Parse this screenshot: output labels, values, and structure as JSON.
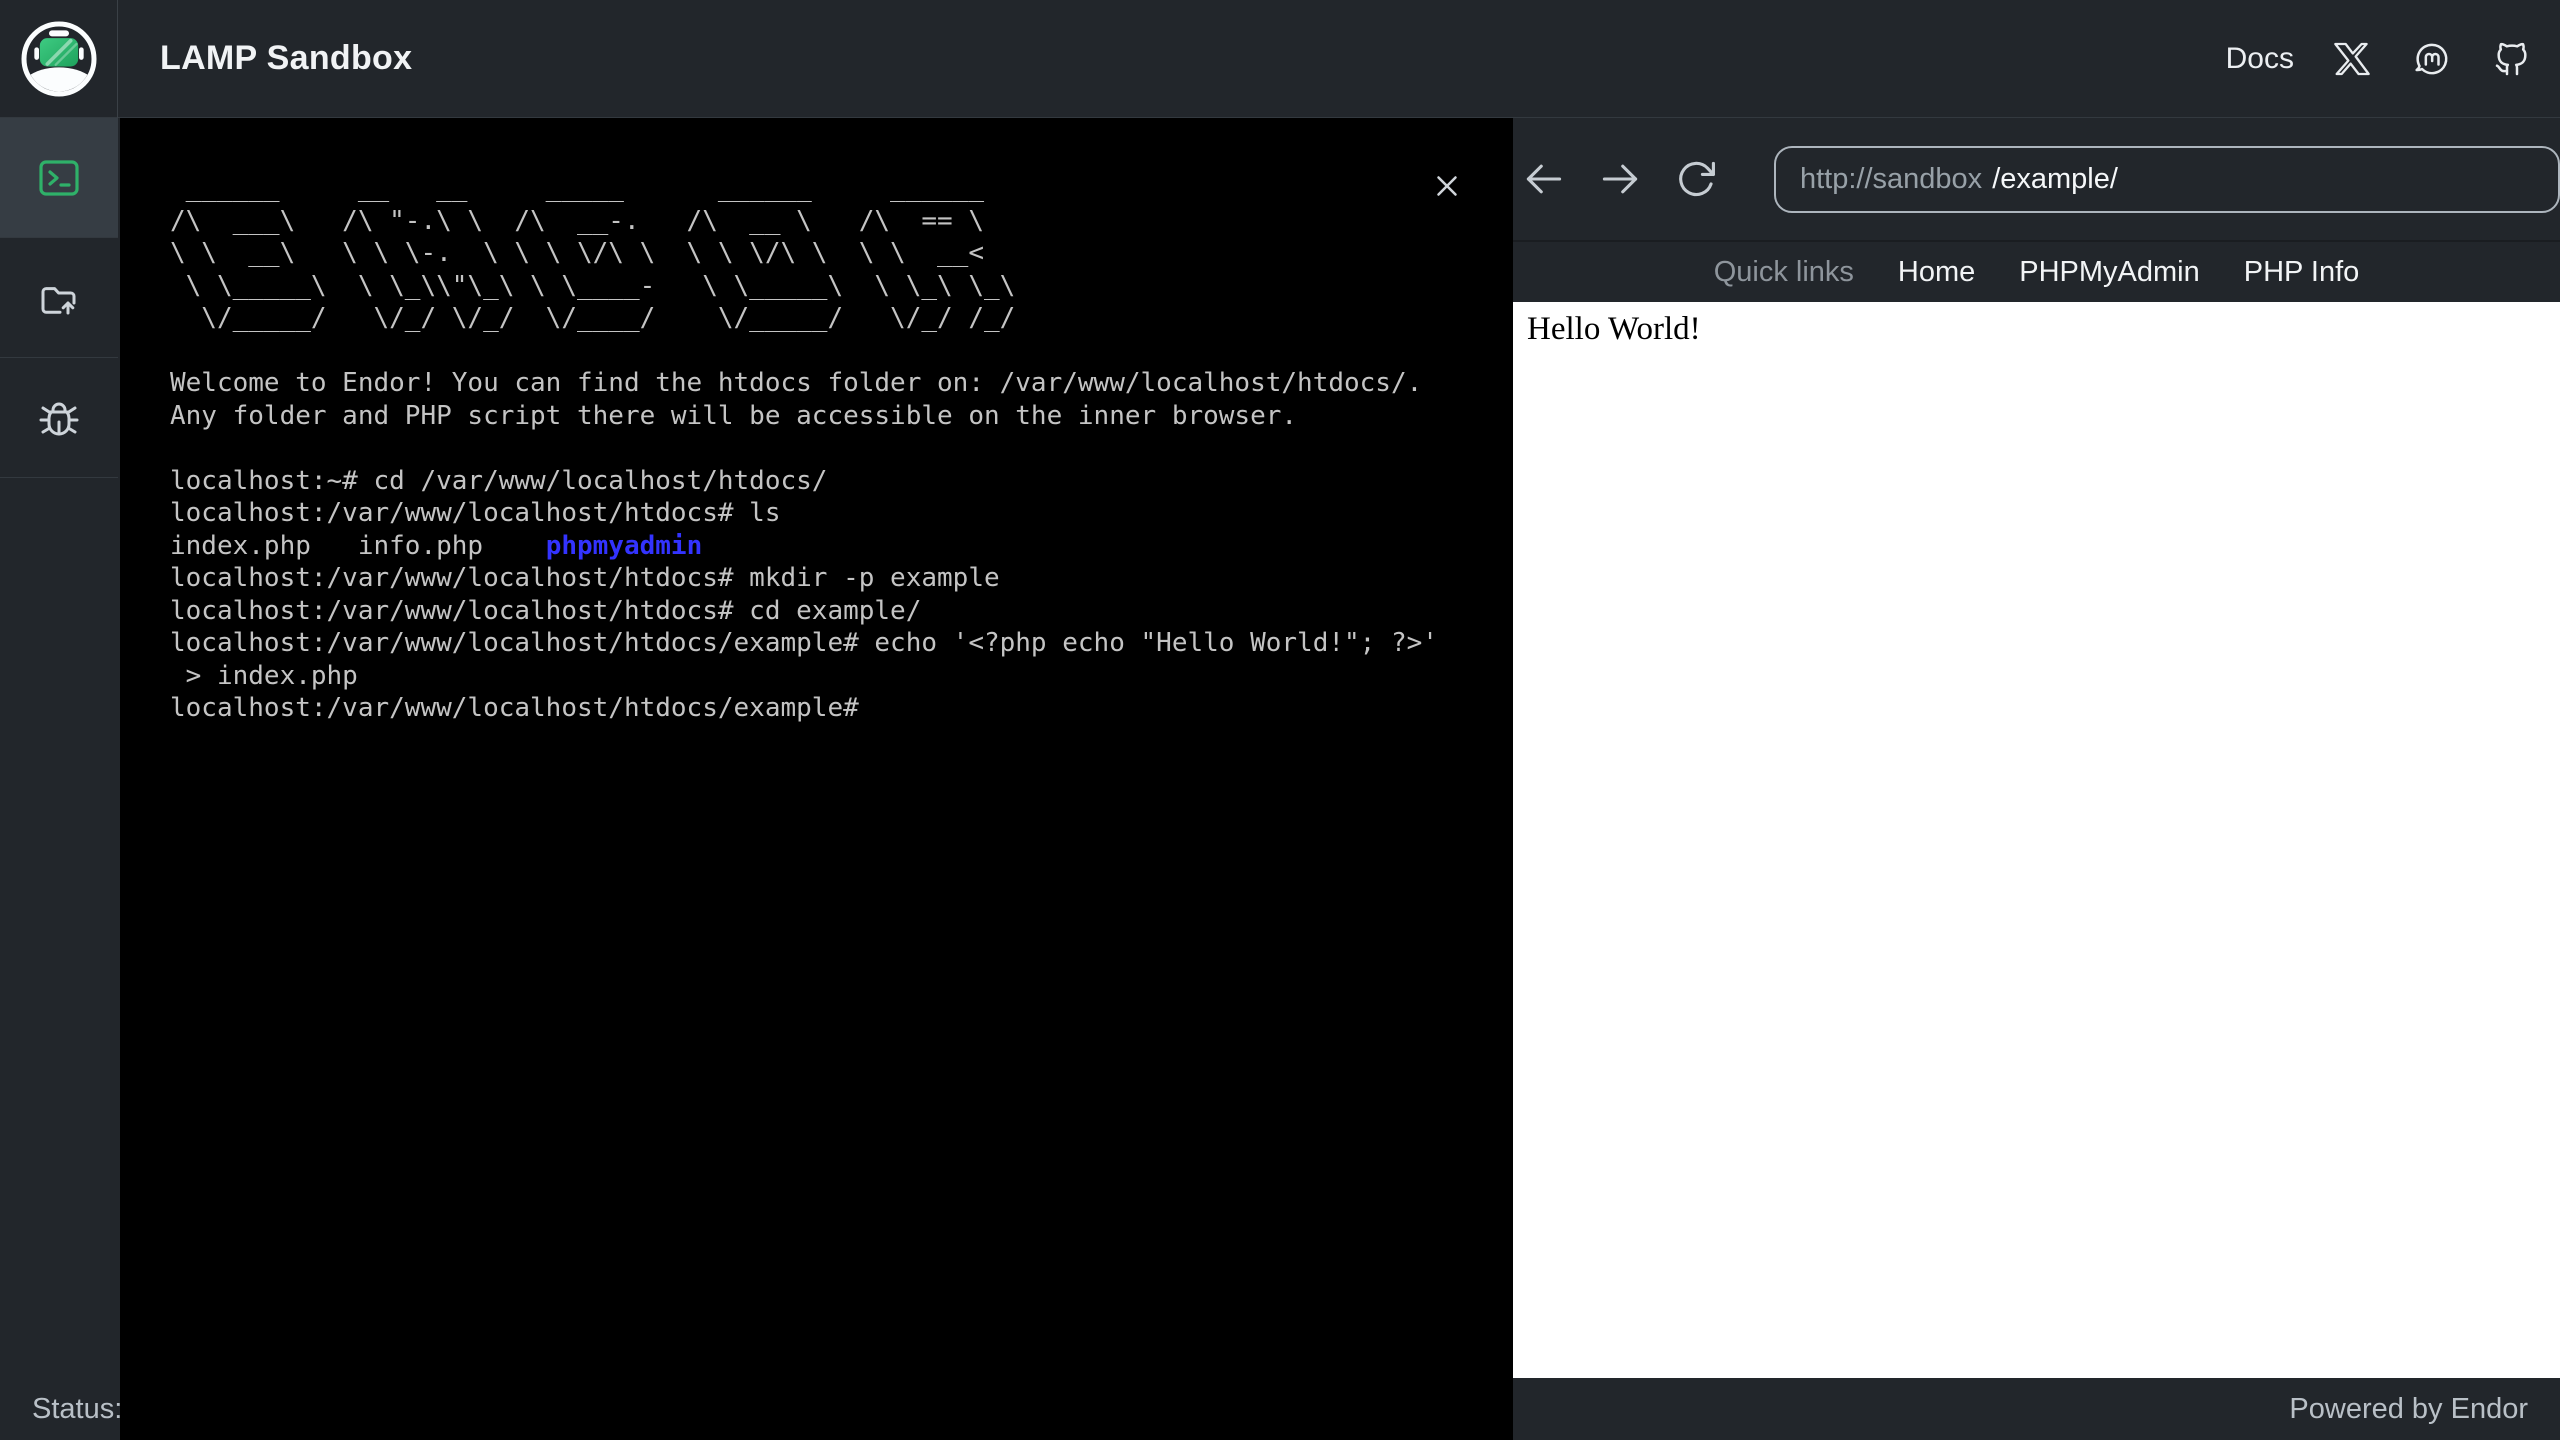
{
  "header": {
    "title": "LAMP Sandbox",
    "docs_label": "Docs"
  },
  "sidebar": {
    "items": [
      {
        "icon": "terminal-icon",
        "active": true
      },
      {
        "icon": "folder-upload-icon",
        "active": false
      },
      {
        "icon": "bug-icon",
        "active": false
      }
    ]
  },
  "terminal": {
    "ascii_art": " ______     __   __     _____      ______     ______    \n/\\  ___\\   /\\ \"-.\\ \\  /\\  __-.   /\\  __ \\   /\\  == \\   \n\\ \\  __\\   \\ \\ \\-.  \\ \\ \\ \\/\\ \\  \\ \\ \\/\\ \\  \\ \\  __<   \n \\ \\_____\\  \\ \\_\\\\\"\\_\\ \\ \\____-   \\ \\_____\\  \\ \\_\\ \\_\\ \n  \\/_____/   \\/_/ \\/_/  \\/____/    \\/_____/   \\/_/ /_/ ",
    "welcome": "Welcome to Endor! You can find the htdocs folder on: /var/www/localhost/htdocs/.\nAny folder and PHP script there will be accessible on the inner browser.",
    "session": [
      {
        "segments": [
          {
            "text": "localhost:~# cd /var/www/localhost/htdocs/"
          }
        ]
      },
      {
        "segments": [
          {
            "text": "localhost:/var/www/localhost/htdocs# ls"
          }
        ]
      },
      {
        "segments": [
          {
            "text": "index.php   info.php    "
          },
          {
            "text": "phpmyadmin",
            "color": "dir"
          }
        ]
      },
      {
        "segments": [
          {
            "text": "localhost:/var/www/localhost/htdocs# mkdir -p example"
          }
        ]
      },
      {
        "segments": [
          {
            "text": "localhost:/var/www/localhost/htdocs# cd example/"
          }
        ]
      },
      {
        "segments": [
          {
            "text": "localhost:/var/www/localhost/htdocs/example# echo '<?php echo \"Hello World!\"; ?>'"
          }
        ]
      },
      {
        "segments": [
          {
            "text": " > index.php"
          }
        ]
      },
      {
        "segments": [
          {
            "text": "localhost:/var/www/localhost/htdocs/example#"
          }
        ]
      }
    ]
  },
  "browser": {
    "url_prefix": "http://sandbox",
    "url_path": "/example/",
    "quick_links_label": "Quick links",
    "quick_links": [
      "Home",
      "PHPMyAdmin",
      "PHP Info"
    ],
    "content": "Hello World!"
  },
  "statusbar": {
    "status_label": "Status:",
    "powered_by": "Powered by Endor"
  },
  "colors": {
    "chrome_bg": "#22262b",
    "accent_green": "#2fb169",
    "terminal_bg": "#000000",
    "terminal_fg": "#c4c4c4",
    "terminal_dir_blue": "#3333ff",
    "url_border": "#adb5bd",
    "page_bg": "#ffffff"
  }
}
